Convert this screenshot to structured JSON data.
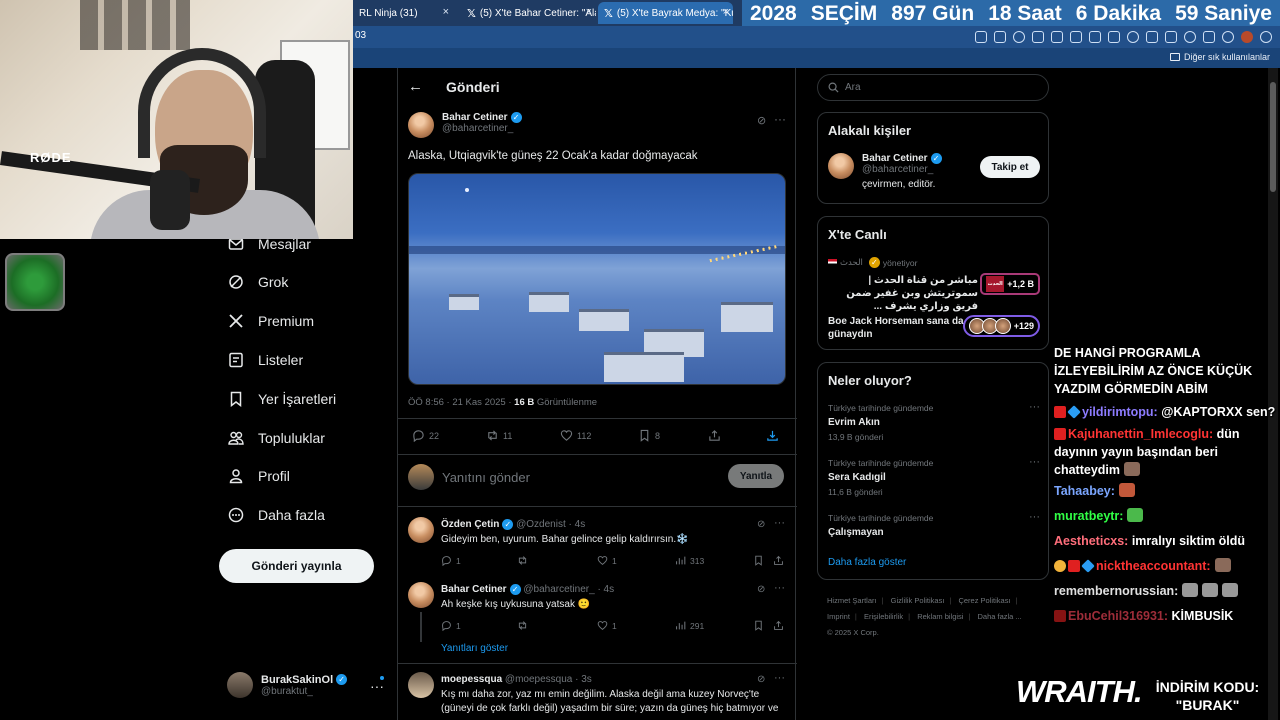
{
  "browser": {
    "tabs": [
      {
        "label": "RL Ninja (31)",
        "has_x_logo": false
      },
      {
        "label": "(5) X'te Bahar Cetiner: \"Ala",
        "has_x_logo": true
      },
      {
        "label": "(5) X'te Bayrak Medya: \"Ku",
        "has_x_logo": true
      }
    ],
    "tab_close": "×",
    "url_fragment": "03",
    "bookmarks_label": "Diğer sık kullanılanlar"
  },
  "countdown": {
    "year": "2028",
    "label": "SEÇİM",
    "days": "897 Gün",
    "hours": "18 Saat",
    "minutes": "6 Dakika",
    "seconds": "59 Saniye"
  },
  "webcam": {
    "mic_brand": "RØDE"
  },
  "sidebar": {
    "items": [
      {
        "label": "Mesajlar",
        "icon": "envelope-icon"
      },
      {
        "label": "Grok",
        "icon": "grok-icon"
      },
      {
        "label": "Premium",
        "icon": "x-logo-icon"
      },
      {
        "label": "Listeler",
        "icon": "list-icon"
      },
      {
        "label": "Yer İşaretleri",
        "icon": "bookmark-icon"
      },
      {
        "label": "Topluluklar",
        "icon": "communities-icon"
      },
      {
        "label": "Profil",
        "icon": "profile-icon"
      },
      {
        "label": "Daha fazla",
        "icon": "more-circle-icon"
      }
    ],
    "post_button": "Gönderi yayınla",
    "account": {
      "name": "BurakSakinOl",
      "handle": "@buraktut_",
      "more": "···"
    }
  },
  "main": {
    "header_title": "Gönderi",
    "tweet": {
      "name": "Bahar Cetiner",
      "handle": "@baharcetiner_",
      "text": "Alaska, Utqiagvik'te güneş 22 Ocak'a kadar doğmayacak",
      "time": "ÖÖ 8:56 · 21 Kas 2025 · ",
      "views_count": "16 B",
      "views_label": " Görüntülenme",
      "replies": "22",
      "retweets": "11",
      "likes": "112",
      "bookmarks": "8",
      "more": "···"
    },
    "reply_box": {
      "placeholder": "Yanıtını gönder",
      "button": "Yanıtla"
    },
    "replies": [
      {
        "name": "Özden Çetin",
        "handle": "@Ozdenist · 4s",
        "text": "Gideyim ben, uyurum. Bahar gelince gelip kaldırırsın.❄️",
        "replies": "1",
        "retweets": "",
        "likes": "1",
        "views": "313"
      },
      {
        "name": "Bahar Cetiner",
        "handle": "@baharcetiner_ · 4s",
        "text": "Ah keşke kış uykusuna yatsak 🙂",
        "replies": "1",
        "retweets": "",
        "likes": "1",
        "views": "291"
      },
      {
        "name": "moepessqua",
        "handle": "@moepessqua · 3s",
        "text": "Kış mı daha zor, yaz mı emin değilim. Alaska değil ama kuzey Norveç'te (güneyi de çok farklı değil) yaşadım bir süre; yazın da güneş hiç batmıyor ve",
        "replies": "",
        "retweets": "",
        "likes": "",
        "views": ""
      }
    ],
    "show_replies": "Yanıtları göster"
  },
  "right": {
    "search_placeholder": "Ara",
    "related": {
      "title": "Alakalı kişiler",
      "name": "Bahar Cetiner",
      "handle": "@baharcetiner_",
      "bio": "çevirmen, editör.",
      "follow": "Takip et"
    },
    "live": {
      "title": "X'te Canlı",
      "items": [
        {
          "host": "الحدث",
          "host_suffix": "yönetiyor",
          "title": "مباشر من قناة الحدث | سموتريتش وبن غفير ضمن فريق وزاري يشرف ...",
          "badge": "+1,2 B",
          "logo_text": "الحدث"
        },
        {
          "host": "",
          "host_suffix": "",
          "title": "Boe Jack Horseman sana da günaydın",
          "badge": "+129",
          "logo_text": ""
        }
      ]
    },
    "trends": {
      "title": "Neler oluyor?",
      "items": [
        {
          "category": "Türkiye tarihinde gündemde",
          "name": "Evrim Akın",
          "count": "13,9 B gönderi"
        },
        {
          "category": "Türkiye tarihinde gündemde",
          "name": "Sera Kadıgil",
          "count": "11,6 B gönderi"
        },
        {
          "category": "Türkiye tarihinde gündemde",
          "name": "Çalışmayan",
          "count": ""
        }
      ],
      "show_more": "Daha fazla göster"
    },
    "footer": [
      "Hizmet Şartları",
      "Gizlilik Politikası",
      "Çerez Politikası",
      "Imprint",
      "Erişilebilirlik",
      "Reklam bilgisi",
      "Daha fazla ...",
      "© 2025 X Corp."
    ]
  },
  "chat": {
    "top_text": "DE HANGİ PROGRAMLA İZLEYEBİLİRİM AZ ÖNCE KÜÇÜK YAZDIM GÖRMEDİN ABİM",
    "messages": [
      {
        "user": "yildirimtopu:",
        "text": "@KAPTORXX sen?"
      },
      {
        "user": "Kajuhanettin_Imlecoglu:",
        "text": "dün dayının yayın başından beri chatteydim"
      },
      {
        "user": "Tahaabey:",
        "text": ""
      },
      {
        "user": "muratbeytr:",
        "text": ""
      },
      {
        "user": "Aestheticxs:",
        "text": "imralıyı siktim öldü"
      },
      {
        "user": "nicktheaccountant:",
        "text": ""
      },
      {
        "user": "remembernorussian:",
        "text": ""
      },
      {
        "user": "EbuCehil316931:",
        "text": "KİMBUSİK"
      }
    ]
  },
  "sponsor": {
    "brand": "WRAITH.",
    "promo_line1": "İNDİRİM KODU:",
    "promo_line2": "\"BURAK\""
  },
  "colors": {
    "accent": "#1d9bf0",
    "background": "#000000",
    "border": "#2f3336",
    "muted": "#71767b"
  }
}
